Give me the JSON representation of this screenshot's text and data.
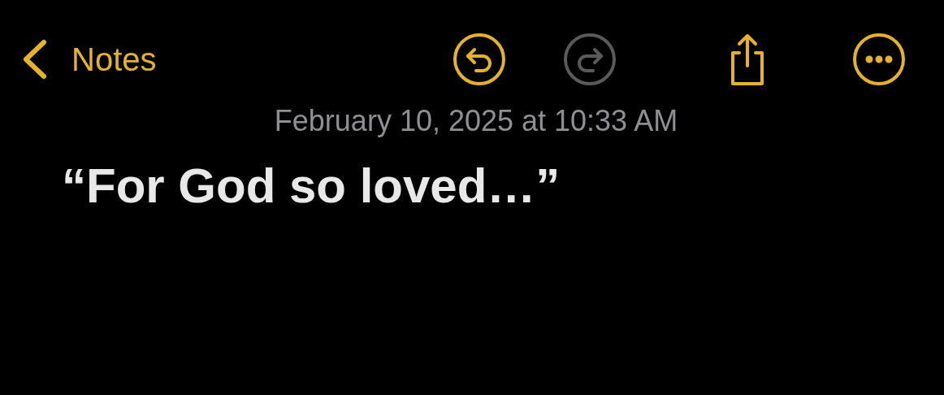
{
  "nav": {
    "back_label": "Notes"
  },
  "toolbar": [
    {
      "kind": "undo",
      "disabled": false
    },
    {
      "kind": "redo",
      "disabled": true
    },
    {
      "kind": "share",
      "disabled": false
    },
    {
      "kind": "more",
      "disabled": false
    }
  ],
  "note": {
    "date": "February 10, 2025 at 10:33 AM",
    "title": "“For God so loved…”"
  }
}
